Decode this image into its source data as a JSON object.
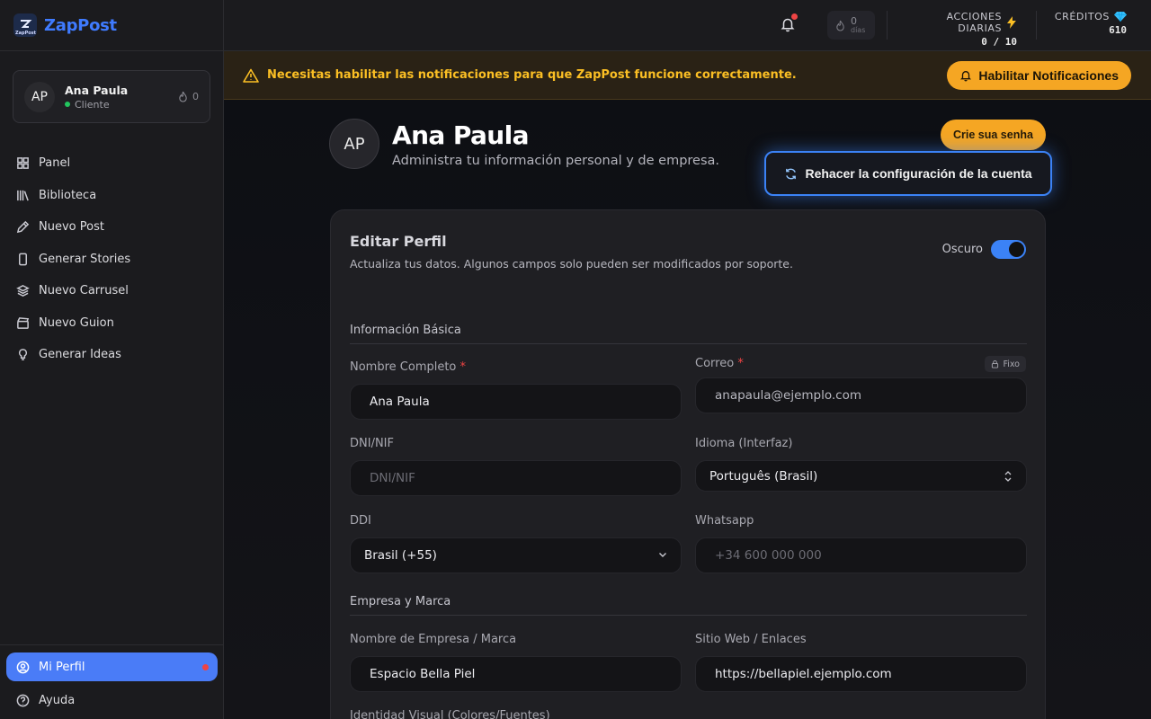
{
  "brand": {
    "name": "ZapPost",
    "logo_text": "ZapPost"
  },
  "user": {
    "initials": "AP",
    "name": "Ana Paula",
    "role": "Cliente",
    "streak": "0"
  },
  "nav": {
    "items": [
      {
        "label": "Panel",
        "icon": "grid-icon"
      },
      {
        "label": "Biblioteca",
        "icon": "library-icon"
      },
      {
        "label": "Nuevo Post",
        "icon": "pen-icon"
      },
      {
        "label": "Generar Stories",
        "icon": "phone-icon"
      },
      {
        "label": "Nuevo Carrusel",
        "icon": "layers-icon"
      },
      {
        "label": "Nuevo Guion",
        "icon": "clapper-icon"
      },
      {
        "label": "Generar Ideas",
        "icon": "lightbulb-icon"
      }
    ],
    "bottom": [
      {
        "label": "Mi Perfil",
        "icon": "user-circle-icon"
      },
      {
        "label": "Ayuda",
        "icon": "help-icon"
      }
    ]
  },
  "topbar": {
    "streak_count": "0",
    "streak_unit": "días",
    "daily_actions_label": "ACCIONES DIARIAS",
    "daily_actions_value": "0 / 10",
    "credits_label": "CRÉDITOS",
    "credits_value": "610"
  },
  "banner": {
    "message": "Necesitas habilitar las notificaciones para que ZapPost funcione correctamente.",
    "button": "Habilitar Notificaciones"
  },
  "profile": {
    "initials": "AP",
    "name": "Ana Paula",
    "subtitle": "Administra tu información personal y de empresa.",
    "create_password_btn": "Crie sua senha",
    "redo_config_btn": "Rehacer la configuración de la cuenta"
  },
  "card": {
    "title": "Editar Perfil",
    "subtitle": "Actualiza tus datos. Algunos campos solo pueden ser modificados por soporte.",
    "theme_label": "Oscuro",
    "theme_dark_on": true,
    "sections": {
      "basic": "Información Básica",
      "company": "Empresa y Marca"
    },
    "fields": {
      "full_name": {
        "label": "Nombre Completo",
        "value": "Ana Paula"
      },
      "email": {
        "label": "Correo",
        "value": "anapaula@ejemplo.com",
        "badge": "Fixo"
      },
      "dni": {
        "label": "DNI/NIF",
        "placeholder": "DNI/NIF"
      },
      "language": {
        "label": "Idioma (Interfaz)",
        "value": "Português (Brasil)"
      },
      "ddi": {
        "label": "DDI",
        "value": "Brasil (+55)"
      },
      "whatsapp": {
        "label": "Whatsapp",
        "placeholder": "+34 600 000 000"
      },
      "company_name": {
        "label": "Nombre de Empresa / Marca",
        "value": "Espacio Bella Piel"
      },
      "website": {
        "label": "Sitio Web / Enlaces",
        "value": "https://bellapiel.ejemplo.com"
      },
      "visual_identity": {
        "label": "Identidad Visual (Colores/Fuentes)"
      }
    }
  },
  "colors": {
    "accent": "#4a7cf7",
    "warning": "#f5a623",
    "danger": "#ef4444",
    "success": "#22c55e"
  }
}
